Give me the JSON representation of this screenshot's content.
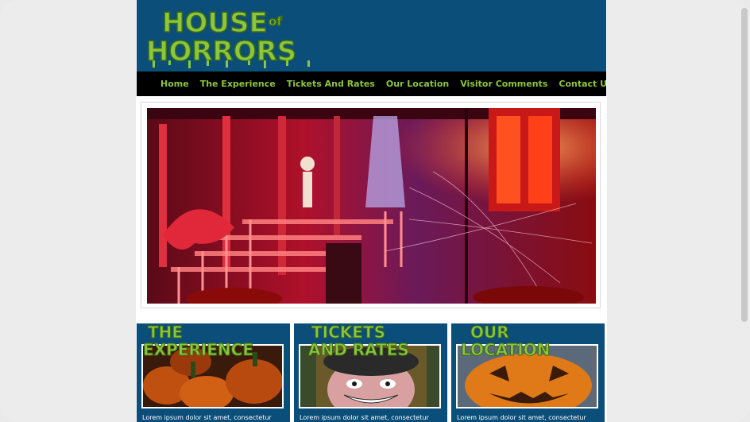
{
  "site": {
    "logo_text": "HOUSE of HORRORS",
    "logo_lines": [
      "HOUSE",
      "of",
      "HORRORS"
    ]
  },
  "nav": {
    "items": [
      "Home",
      "The Experience",
      "Tickets And Rates",
      "Our Location",
      "Visitor Comments",
      "Contact Us"
    ]
  },
  "panels": [
    {
      "title_lines": [
        "THE",
        "EXPERIENCE"
      ],
      "text": "Lorem ipsum dolor sit amet, consectetur"
    },
    {
      "title_lines": [
        "TICKETS",
        "AND RATES"
      ],
      "text": "Lorem ipsum dolor sit amet, consectetur"
    },
    {
      "title_lines": [
        "OUR",
        "LOCATION"
      ],
      "text": "Lorem ipsum dolor sit amet, consectetur"
    }
  ],
  "colors": {
    "header_bg": "#0a4e79",
    "nav_bg": "#000000",
    "accent_green": "#8cc63f"
  }
}
